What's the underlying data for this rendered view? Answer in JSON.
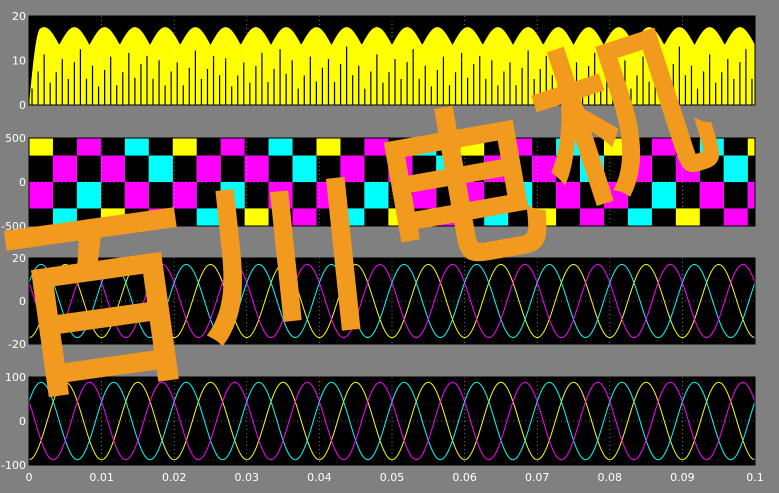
{
  "figure": {
    "background": "#808080",
    "axes_background": "#000000",
    "tick_color": "#ffffff",
    "grid_style": "dotted",
    "x_tick_labels": [
      "0",
      "0.01",
      "0.02",
      "0.03",
      "0.04",
      "0.05",
      "0.06",
      "0.07",
      "0.08",
      "0.09",
      "0.1"
    ],
    "watermark": "百川电机",
    "watermark_color": "#f29a1e"
  },
  "chart_data": [
    {
      "type": "line",
      "subplot": 1,
      "title": "",
      "xlabel": "",
      "ylabel": "",
      "xlim": [
        0,
        0.1
      ],
      "ylim": [
        0,
        20
      ],
      "grid": true,
      "y_tick_labels": [
        "0",
        "10",
        "20"
      ],
      "y_ticks": [
        0,
        10,
        20
      ],
      "colors": [
        "#ffff00",
        "#000000"
      ],
      "series": [
        {
          "values": {
            "ripple_min": 13.5,
            "ripple_max": 17.5,
            "ripple_periods": 24,
            "rise_time": 0.0015,
            "switching_dips_to": 0
          }
        }
      ]
    },
    {
      "type": "line",
      "subplot": 2,
      "title": "",
      "xlabel": "",
      "ylabel": "",
      "xlim": [
        0,
        0.1
      ],
      "ylim": [
        -500,
        500
      ],
      "grid": true,
      "y_tick_labels": [
        "500",
        "0",
        "-500"
      ],
      "y_ticks": [
        500,
        0,
        -500
      ],
      "levels": [
        -450,
        -150,
        150,
        450
      ],
      "step_period": 0.0033,
      "colors": [
        "#ffff00",
        "#00ffff",
        "#ff00ff"
      ]
    },
    {
      "type": "line",
      "subplot": 3,
      "title": "",
      "xlabel": "",
      "ylabel": "",
      "xlim": [
        0,
        0.1
      ],
      "ylim": [
        -20,
        20
      ],
      "grid": true,
      "y_tick_labels": [
        "20",
        "0",
        "-20"
      ],
      "y_ticks": [
        20,
        0,
        -20
      ],
      "frequency_hz": 100,
      "amplitude": 17,
      "colors": [
        "#ffff00",
        "#00ffff",
        "#ff00ff"
      ]
    },
    {
      "type": "line",
      "subplot": 4,
      "title": "",
      "xlabel": "",
      "ylabel": "",
      "xlim": [
        0,
        0.1
      ],
      "ylim": [
        -100,
        100
      ],
      "grid": true,
      "y_tick_labels": [
        "100",
        "0",
        "-100"
      ],
      "y_ticks": [
        100,
        0,
        -100
      ],
      "frequency_hz": 100,
      "amplitude": 88,
      "colors": [
        "#ffff00",
        "#00ffff",
        "#ff00ff"
      ]
    }
  ]
}
